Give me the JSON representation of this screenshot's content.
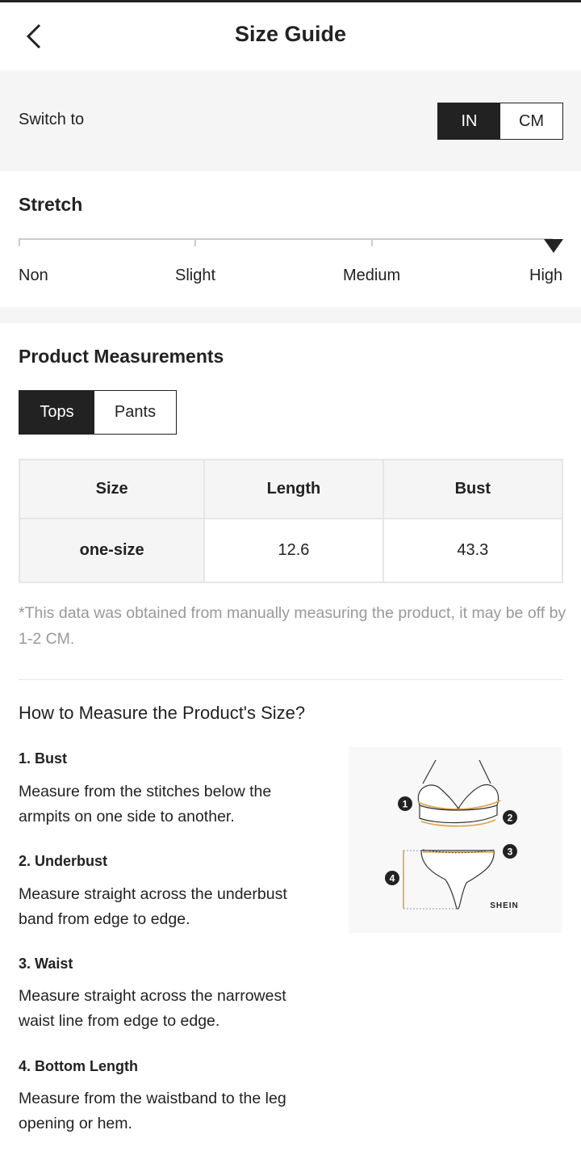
{
  "header": {
    "title": "Size Guide"
  },
  "switch": {
    "label": "Switch to",
    "options": [
      "IN",
      "CM"
    ],
    "selected": "IN"
  },
  "stretch": {
    "title": "Stretch",
    "levels": [
      "Non",
      "Slight",
      "Medium",
      "High"
    ],
    "selected": "High"
  },
  "measurements": {
    "title": "Product Measurements",
    "tabs": [
      "Tops",
      "Pants"
    ],
    "active_tab": "Tops",
    "table": {
      "headers": [
        "Size",
        "Length",
        "Bust"
      ],
      "rows": [
        [
          "one-size",
          "12.6",
          "43.3"
        ]
      ]
    },
    "note": "*This data was obtained from manually measuring the product, it may be off by 1-2 CM."
  },
  "how_to": {
    "title": "How to Measure the Product's Size?",
    "steps": [
      {
        "title": "1. Bust",
        "desc": "Measure from the stitches below the armpits on one side to another."
      },
      {
        "title": "2. Underbust",
        "desc": "Measure straight across the underbust band from edge to edge."
      },
      {
        "title": "3. Waist",
        "desc": "Measure straight across the narrowest waist line from edge to edge."
      },
      {
        "title": "4. Bottom Length",
        "desc": "Measure from the waistband to the leg opening or hem."
      }
    ],
    "diagram": {
      "brand": "SHEIN",
      "markers": [
        "1",
        "2",
        "3",
        "4"
      ],
      "accent_color": "#e0a040"
    }
  }
}
